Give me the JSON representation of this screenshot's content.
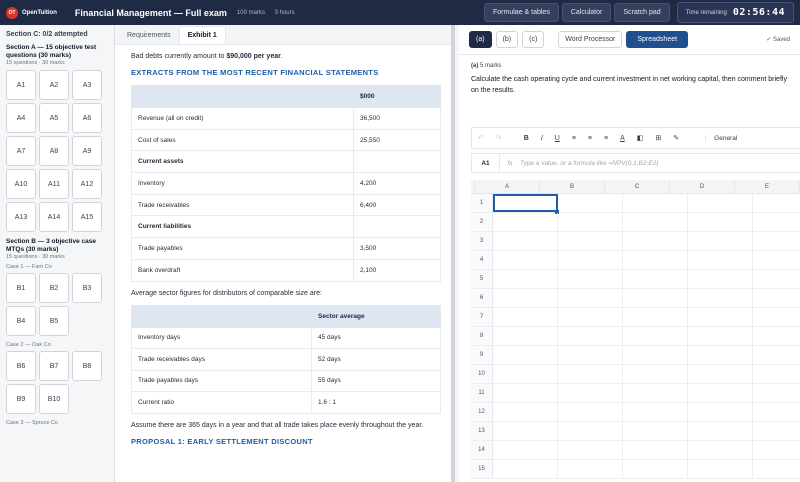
{
  "topbar": {
    "logo_mark": "OT",
    "logo_text": "OpenTuition",
    "exam_title": "Financial Management — Full exam",
    "marks": "100 marks",
    "duration": "3 hours",
    "buttons": [
      "Formulae & tables",
      "Calculator",
      "Scratch pad"
    ],
    "timer_label": "Time remaining",
    "timer_value": "02:56:44"
  },
  "leftnav": {
    "header": "Section C: 0/2 attempted",
    "section_a": {
      "title": "Section A — 15 objective test questions (30 marks)",
      "meta": "15 questions · 30 marks",
      "questions": [
        "A1",
        "A2",
        "A3",
        "A4",
        "A5",
        "A6",
        "A7",
        "A8",
        "A9",
        "A10",
        "A11",
        "A12",
        "A13",
        "A14",
        "A15"
      ]
    },
    "section_b": {
      "title": "Section B — 3 objective case MTQs (30 marks)",
      "meta": "15 questions · 30 marks",
      "cases": [
        {
          "label": "Case 1 — Farn Co",
          "questions": [
            "B1",
            "B2",
            "B3",
            "B4",
            "B5"
          ]
        },
        {
          "label": "Case 2 — Oak Co",
          "questions": [
            "B6",
            "B7",
            "B8",
            "B9",
            "B10"
          ]
        },
        {
          "label": "Case 3 — Spruce Co",
          "questions": []
        }
      ]
    }
  },
  "middle": {
    "tabs": [
      "Requirements",
      "Exhibit 1"
    ],
    "active_tab": "Exhibit 1",
    "intro_prefix": "Bad debts currently amount to ",
    "intro_bold": "$90,000 per year",
    "intro_suffix": ".",
    "heading1": "EXTRACTS FROM THE MOST RECENT FINANCIAL STATEMENTS",
    "fin_table": {
      "header": [
        "",
        "$000"
      ],
      "rows": [
        {
          "label": "Revenue (all on credit)",
          "value": "36,500",
          "bold": false
        },
        {
          "label": "Cost of sales",
          "value": "25,550",
          "bold": false
        },
        {
          "label": "Current assets",
          "value": "",
          "bold": true
        },
        {
          "label": "Inventory",
          "value": "4,200",
          "bold": false
        },
        {
          "label": "Trade receivables",
          "value": "6,400",
          "bold": false
        },
        {
          "label": "Current liabilities",
          "value": "",
          "bold": true
        },
        {
          "label": "Trade payables",
          "value": "3,500",
          "bold": false
        },
        {
          "label": "Bank overdraft",
          "value": "2,100",
          "bold": false
        }
      ]
    },
    "sector_intro": "Average sector figures for distributors of comparable size are:",
    "sector_table": {
      "header": [
        "",
        "Sector average"
      ],
      "rows": [
        {
          "label": "Inventory days",
          "value": "45 days"
        },
        {
          "label": "Trade receivables days",
          "value": "52 days"
        },
        {
          "label": "Trade payables days",
          "value": "55 days"
        },
        {
          "label": "Current ratio",
          "value": "1.6 : 1"
        }
      ]
    },
    "assumption": "Assume there are 365 days in a year and that all trade takes place evenly throughout the year.",
    "heading2": "PROPOSAL 1: EARLY SETTLEMENT DISCOUNT"
  },
  "right": {
    "parts": [
      "(a)",
      "(b)",
      "(c)"
    ],
    "modes": [
      "Word Processor",
      "Spreadsheet"
    ],
    "active_mode": "Spreadsheet",
    "saved": "✓ Saved",
    "question_part": "(a)",
    "question_marks": "5 marks",
    "question_text": "Calculate the cash operating cycle and current investment in net working capital, then comment briefly on the results.",
    "format": {
      "undo": "↶",
      "redo": "↷",
      "bold": "B",
      "italic": "I",
      "underline": "U",
      "align_left": "≡",
      "align_center": "≡",
      "align_right": "≡",
      "text_color": "A",
      "fill": "◧",
      "borders": "⊞",
      "pen": "✎",
      "number_format": "General"
    },
    "formula_bar": {
      "cell_ref": "A1",
      "fx": "fx",
      "placeholder": "Type a value, or a formula like =NPV(0.1,B2:E2)"
    },
    "columns": [
      "A",
      "B",
      "C",
      "D",
      "E"
    ],
    "rows": [
      "1",
      "2",
      "3",
      "4",
      "5",
      "6",
      "7",
      "8",
      "9",
      "10",
      "11",
      "12",
      "13",
      "14",
      "15"
    ],
    "selected_cell": "A1"
  }
}
